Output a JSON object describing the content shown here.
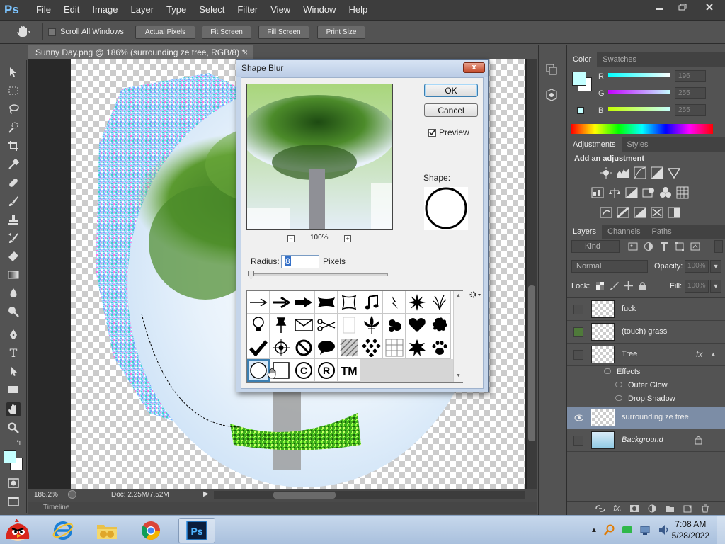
{
  "app": {
    "logo": "Ps"
  },
  "menu": [
    "File",
    "Edit",
    "Image",
    "Layer",
    "Type",
    "Select",
    "Filter",
    "View",
    "Window",
    "Help"
  ],
  "options_bar": {
    "scroll_all_windows": "Scroll All Windows",
    "actual_pixels": "Actual Pixels",
    "fit_screen": "Fit Screen",
    "fill_screen": "Fill Screen",
    "print_size": "Print Size"
  },
  "document": {
    "tab_title": "Sunny Day.png @ 186% (surrounding ze tree, RGB/8) *",
    "close": "×",
    "zoom": "186.2%",
    "doc_size": "Doc: 2.25M/7.52M",
    "timeline": "Timeline"
  },
  "dialog": {
    "title": "Shape Blur",
    "ok": "OK",
    "cancel": "Cancel",
    "preview_label": "Preview",
    "preview_checked": true,
    "preview_zoom": "100%",
    "shape_label": "Shape:",
    "radius_label": "Radius:",
    "radius_value": "8",
    "radius_unit": "Pixels",
    "close": "x"
  },
  "color_panel": {
    "tabs": [
      "Color",
      "Swatches"
    ],
    "channels": [
      {
        "label": "R",
        "value": "196"
      },
      {
        "label": "G",
        "value": "255"
      },
      {
        "label": "B",
        "value": "255"
      }
    ],
    "foreground": "#c4ffff"
  },
  "adjustments_panel": {
    "tabs": [
      "Adjustments",
      "Styles"
    ],
    "heading": "Add an adjustment"
  },
  "layers_panel": {
    "tabs": [
      "Layers",
      "Channels",
      "Paths"
    ],
    "filter_kind": "Kind",
    "blend_mode": "Normal",
    "opacity_label": "Opacity:",
    "opacity_value": "100%",
    "lock_label": "Lock:",
    "fill_label": "Fill:",
    "fill_value": "100%",
    "layers": [
      {
        "name": "fuck"
      },
      {
        "name": "(touch) grass"
      },
      {
        "name": "Tree",
        "fx": "fx"
      },
      {
        "name": "surrounding ze tree"
      },
      {
        "name": "Background"
      }
    ],
    "effects_label": "Effects",
    "effects": [
      "Outer Glow",
      "Drop Shadow"
    ]
  },
  "taskbar": {
    "time": "7:08 AM",
    "date": "5/28/2022"
  }
}
